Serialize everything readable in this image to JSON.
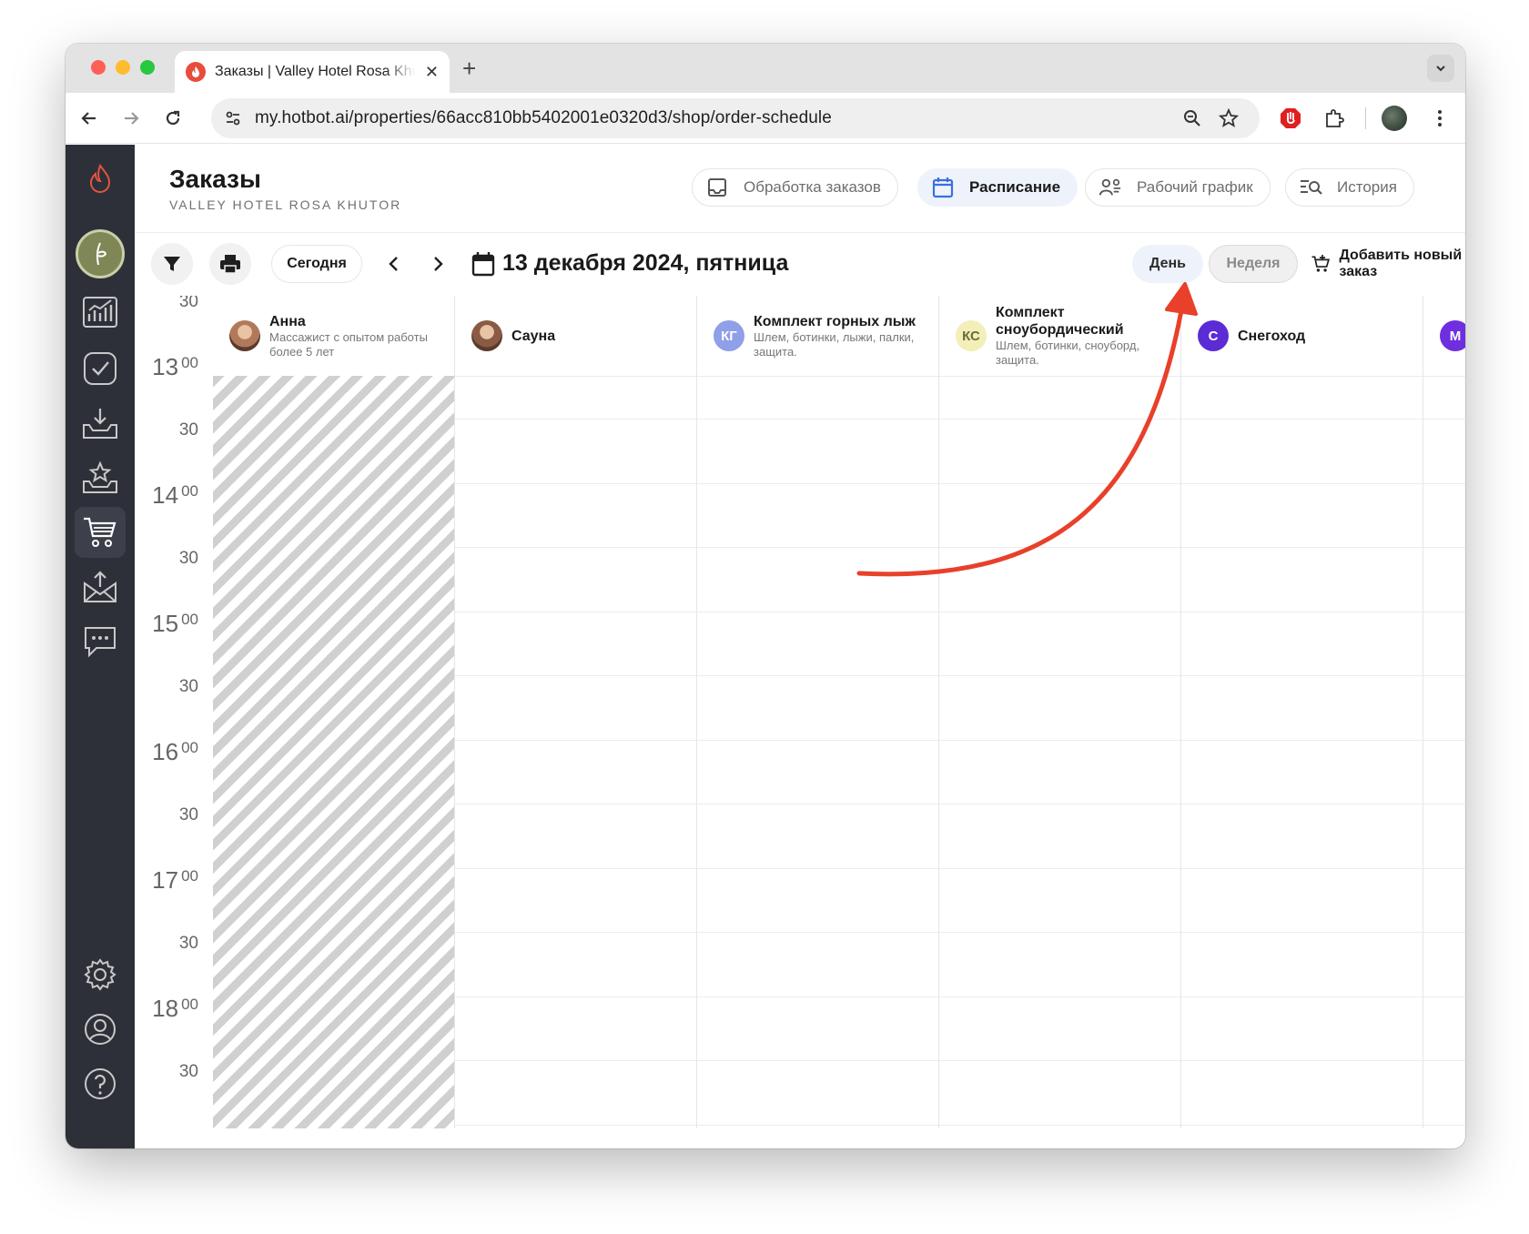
{
  "browser": {
    "tab_title": "Заказы | Valley Hotel Rosa Khutor",
    "url": "my.hotbot.ai/properties/66acc810bb5402001e0320d3/shop/order-schedule"
  },
  "sidebar": {
    "items": [
      {
        "icon": "flame-logo-icon"
      },
      {
        "icon": "property-avatar-icon"
      },
      {
        "icon": "analytics-icon"
      },
      {
        "icon": "tasks-check-icon"
      },
      {
        "icon": "inbox-download-icon"
      },
      {
        "icon": "reviews-star-icon"
      },
      {
        "icon": "shop-cart-icon",
        "active": true
      },
      {
        "icon": "mail-upload-icon"
      },
      {
        "icon": "chat-icon"
      },
      {
        "icon": "settings-gear-icon"
      },
      {
        "icon": "user-profile-icon"
      },
      {
        "icon": "help-icon"
      }
    ]
  },
  "header": {
    "title": "Заказы",
    "subtitle": "VALLEY HOTEL ROSA KHUTOR",
    "tabs": [
      {
        "label": "Обработка заказов",
        "icon": "inbox-tray-icon",
        "active": false
      },
      {
        "label": "Расписание",
        "icon": "calendar-icon",
        "active": true
      },
      {
        "label": "Рабочий график",
        "icon": "staff-schedule-icon",
        "active": false
      },
      {
        "label": "История",
        "icon": "history-search-icon",
        "active": false
      }
    ]
  },
  "controls": {
    "today_label": "Сегодня",
    "date_label": "13 декабря 2024, пятница",
    "view_day": "День",
    "view_week": "Неделя",
    "add_order_label": "Добавить новый заказ"
  },
  "schedule": {
    "times": [
      {
        "hour": "",
        "min": "30"
      },
      {
        "hour": "13",
        "min": "00"
      },
      {
        "hour": "",
        "min": "30"
      },
      {
        "hour": "14",
        "min": "00"
      },
      {
        "hour": "",
        "min": "30"
      },
      {
        "hour": "15",
        "min": "00"
      },
      {
        "hour": "",
        "min": "30"
      },
      {
        "hour": "16",
        "min": "00"
      },
      {
        "hour": "",
        "min": "30"
      },
      {
        "hour": "17",
        "min": "00"
      },
      {
        "hour": "",
        "min": "30"
      },
      {
        "hour": "18",
        "min": "00"
      },
      {
        "hour": "",
        "min": "30"
      }
    ],
    "resources": [
      {
        "name": "Анна",
        "desc": "Массажист с опытом работы более 5 лет",
        "avatar": "",
        "avatar_type": "photo",
        "avatar_color": "#b07a5a",
        "unavailable": true
      },
      {
        "name": "Сауна",
        "desc": "",
        "avatar": "",
        "avatar_type": "photo",
        "avatar_color": "#8a5a44",
        "unavailable": false
      },
      {
        "name": "Комплект горных лыж",
        "desc": "Шлем, ботинки, лыжи, палки, защита.",
        "avatar": "КГ",
        "avatar_type": "initials",
        "avatar_color": "#8f9fe8",
        "avatar_text_color": "#ffffff",
        "unavailable": false
      },
      {
        "name": "Комплект сноубордический",
        "desc": "Шлем, ботинки, сноуборд, защита.",
        "avatar": "КС",
        "avatar_type": "initials",
        "avatar_color": "#f2efb8",
        "avatar_text_color": "#6b6b3a",
        "unavailable": false
      },
      {
        "name": "Снегоход",
        "desc": "",
        "avatar": "С",
        "avatar_type": "initials",
        "avatar_color": "#5b2bd6",
        "avatar_text_color": "#ffffff",
        "unavailable": false
      },
      {
        "name": "",
        "desc": "",
        "avatar": "М",
        "avatar_type": "initials",
        "avatar_color": "#6f2ee0",
        "avatar_text_color": "#ffffff",
        "unavailable": false
      }
    ]
  },
  "colors": {
    "sidebar_bg": "#2e3039",
    "accent_blue": "#3b6fe0",
    "annotation_arrow": "#e8402a"
  }
}
